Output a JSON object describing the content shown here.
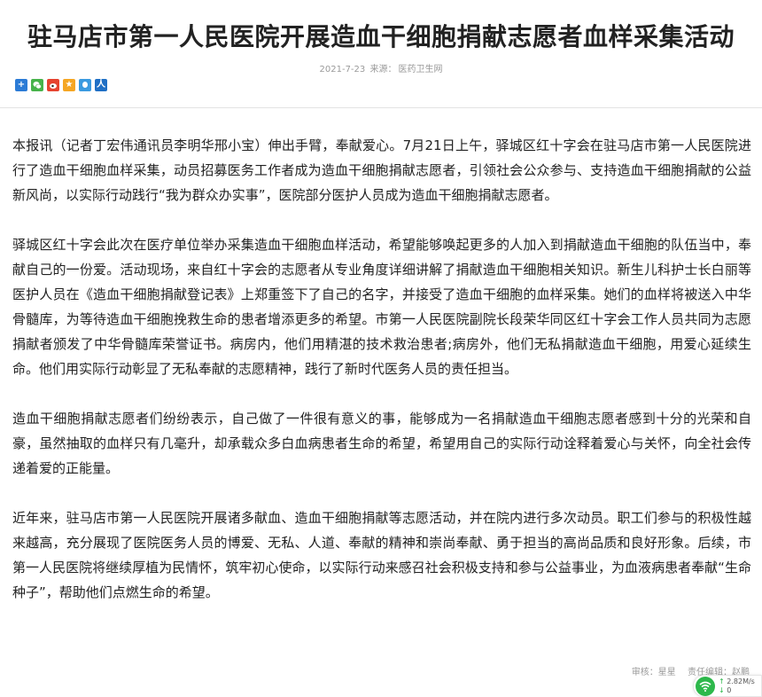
{
  "article": {
    "title": "驻马店市第一人民医院开展造血干细胞捐献志愿者血样采集活动",
    "date": "2021-7-23",
    "source_label": "来源：",
    "source": "医药卫生网",
    "paragraphs": [
      "本报讯（记者丁宏伟通讯员李明华邢小宝）伸出手臂，奉献爱心。7月21日上午，驿城区红十字会在驻马店市第一人民医院进行了造血干细胞血样采集，动员招募医务工作者成为造血干细胞捐献志愿者，引领社会公众参与、支持造血干细胞捐献的公益新风尚，以实际行动践行“我为群众办实事”，医院部分医护人员成为造血干细胞捐献志愿者。",
      "驿城区红十字会此次在医疗单位举办采集造血干细胞血样活动，希望能够唤起更多的人加入到捐献造血干细胞的队伍当中，奉献自己的一份爱。活动现场，来自红十字会的志愿者从专业角度详细讲解了捐献造血干细胞相关知识。新生儿科护士长白丽等医护人员在《造血干细胞捐献登记表》上郑重签下了自己的名字，并接受了造血干细胞的血样采集。她们的血样将被送入中华骨髓库，为等待造血干细胞挽救生命的患者增添更多的希望。市第一人民医院副院长段荣华同区红十字会工作人员共同为志愿捐献者颁发了中华骨髓库荣誉证书。病房内，他们用精湛的技术救治患者;病房外，他们无私捐献造血干细胞，用爱心延续生命。他们用实际行动彰显了无私奉献的志愿精神，践行了新时代医务人员的责任担当。",
      "造血干细胞捐献志愿者们纷纷表示，自己做了一件很有意义的事，能够成为一名捐献造血干细胞志愿者感到十分的光荣和自豪，虽然抽取的血样只有几毫升，却承载众多白血病患者生命的希望，希望用自己的实际行动诠释着爱心与关怀，向全社会传递着爱的正能量。",
      "近年来，驻马店市第一人民医院开展诸多献血、造血干细胞捐献等志愿活动，并在院内进行多次动员。职工们参与的积极性越来越高，充分展现了医院医务人员的博爱、无私、人道、奉献的精神和崇尚奉献、勇于担当的高尚品质和良好形象。后续，市第一人民医院将继续厚植为民情怀，筑牢初心使命，以实际行动来感召社会积极支持和参与公益事业，为血液病患者奉献“生命种子”，帮助他们点燃生命的希望。"
    ],
    "reviewer": "审核：星星",
    "editor": "责任编辑：赵鹏"
  },
  "share_icons": [
    {
      "name": "share-more-icon",
      "glyph": "+",
      "color": "#2b7bd6"
    },
    {
      "name": "wechat-icon",
      "glyph": "✆",
      "color": "#47b34a"
    },
    {
      "name": "weibo-icon",
      "glyph": "◉",
      "color": "#e6432f"
    },
    {
      "name": "qzone-icon",
      "glyph": "★",
      "color": "#f5a623"
    },
    {
      "name": "qq-icon",
      "glyph": "◎",
      "color": "#3a9ae0"
    },
    {
      "name": "renren-icon",
      "glyph": "人",
      "color": "#1f6fc5"
    }
  ],
  "network_widget": {
    "upload": "2.82M/s",
    "download": "0"
  }
}
